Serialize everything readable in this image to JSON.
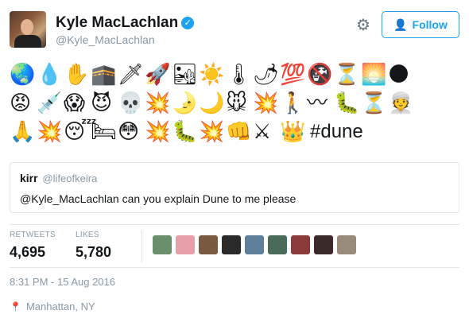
{
  "author": {
    "name": "Kyle MacLachlan",
    "handle": "@Kyle_MacLachlan",
    "verified": true,
    "avatar_icon": "profile-photo"
  },
  "actions": {
    "settings_icon": "gear-icon",
    "follow_label": "Follow",
    "follow_icon": "add-user-icon",
    "accent_color": "#1da1f2"
  },
  "tweet": {
    "emoji_lines": [
      [
        "🌏",
        "💧",
        "✋",
        "🕋",
        "🗡",
        "🚀",
        "🏜",
        "☀️",
        "🌡",
        "🌶",
        "💯",
        "🚱",
        "⏳",
        "🌅",
        "🌑"
      ],
      [
        "😡",
        "💉",
        "😱",
        "😈",
        "💀",
        "💥",
        "🌛",
        "🌙",
        "🐭",
        "💥",
        "🚶",
        "〰",
        "🐛",
        "⏳",
        "👳"
      ],
      [
        "🙏",
        "💥",
        "😴",
        "🛏",
        "😳",
        "💥",
        "🐛",
        "💥",
        "👊",
        "⚔",
        "👑"
      ]
    ],
    "hashtag": "#dune"
  },
  "quote": {
    "name": "kirr",
    "handle": "@lifeofkeira",
    "text": "@Kyle_MacLachlan can you explain Dune to me please"
  },
  "stats": {
    "retweets_label": "RETWEETS",
    "retweets": "4,695",
    "likes_label": "LIKES",
    "likes": "5,780"
  },
  "likers": [
    {
      "color": "#6b8f6a"
    },
    {
      "color": "#e8a0a8"
    },
    {
      "color": "#7a5a40"
    },
    {
      "color": "#2a2a2a"
    },
    {
      "color": "#5f7f9a"
    },
    {
      "color": "#4a6a5a"
    },
    {
      "color": "#8a3a3a"
    },
    {
      "color": "#3a2a2a"
    },
    {
      "color": "#9a8a7a"
    }
  ],
  "timestamp": "8:31 PM - 15 Aug 2016",
  "location": {
    "icon": "map-pin-icon",
    "text": "Manhattan, NY"
  }
}
